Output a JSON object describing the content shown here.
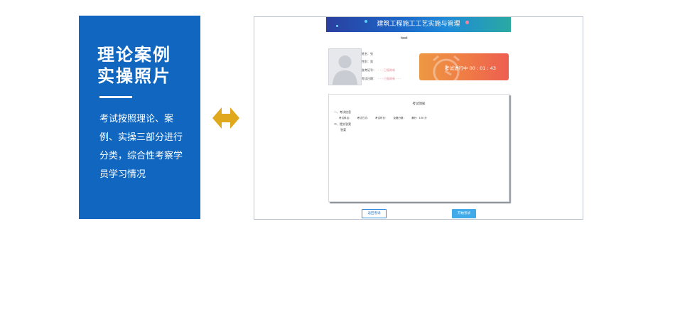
{
  "promo": {
    "title_line1": "理论案例",
    "title_line2": "实操照片",
    "desc": "考试按照理论、案例、实操三部分进行分类，综合性考察学员学习情况"
  },
  "arrow": {
    "icon": "double-arrow-icon",
    "color": "#e0a81c"
  },
  "screen": {
    "banner_title": "建筑工程施工工艺实施与管理",
    "exam_label": "test",
    "info": {
      "name_label": "姓名：",
      "name_value": "张",
      "gender_label": "性别：",
      "gender_value": "男",
      "id_label": "准考证号：",
      "id_value": "- - - 已报刷新",
      "time_label": "考试日期：",
      "time_value": "- - - 已报刷新 - - -"
    },
    "timer_text": "考试进行中 00 : 01 : 43",
    "paper": {
      "title": "考试须知",
      "section1": "一、考试信息",
      "meta": [
        "考试科目：",
        "考试方式：",
        "考试时长：",
        "及格分数：",
        "满分：100 分"
      ],
      "section2": "二、提交答案",
      "answer": "答案"
    },
    "buttons": {
      "back": "返回考试",
      "start": "开始考试"
    }
  }
}
